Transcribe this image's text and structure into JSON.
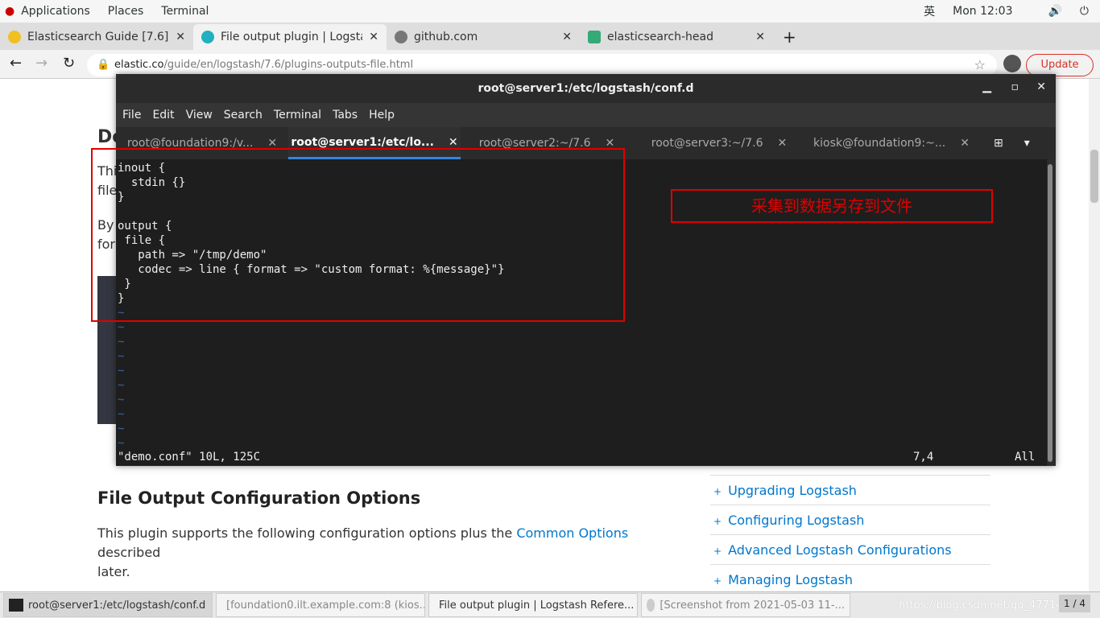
{
  "topbar": {
    "applications": "Applications",
    "places": "Places",
    "terminal": "Terminal",
    "ime": "英",
    "clock": "Mon 12:03"
  },
  "browser": {
    "tabs": [
      {
        "title": "Elasticsearch Guide [7.6] |"
      },
      {
        "title": "File output plugin | Logstash"
      },
      {
        "title": "github.com"
      },
      {
        "title": "elasticsearch-head"
      }
    ],
    "url_host": "elastic.co",
    "url_path": "/guide/en/logstash/7.6/plugins-outputs-file.html",
    "update": "Update"
  },
  "page": {
    "heading_partial": "De",
    "p1a": "Thi",
    "p1b": "file",
    "p2a": "By",
    "p2b": "forr",
    "section_heading": "File Output Configuration Options",
    "para_pre": "This plugin supports the following configuration options plus the ",
    "para_link": "Common Options",
    "para_post": " described",
    "para_line2": "later.",
    "sidebar": [
      "Upgrading Logstash",
      "Configuring Logstash",
      "Advanced Logstash Configurations",
      "Managing Logstash"
    ]
  },
  "terminal": {
    "title": "root@server1:/etc/logstash/conf.d",
    "menu": [
      "File",
      "Edit",
      "View",
      "Search",
      "Terminal",
      "Tabs",
      "Help"
    ],
    "tabs": [
      "root@foundation9:/v...",
      "root@server1:/etc/lo...",
      "root@server2:~/7.6",
      "root@server3:~/7.6",
      "kiosk@foundation9:~..."
    ],
    "lines": [
      "inout {",
      "  stdin {}",
      "}",
      "",
      "output {",
      " file {",
      "   path => \"/tmp/demo\"",
      "   codec => line { format => \"custom format: %{message}\"}",
      " }",
      "}"
    ],
    "tildes": 10,
    "status_left": "\"demo.conf\" 10L, 125C",
    "status_pos": "7,4",
    "status_all": "All",
    "annotation": "采集到数据另存到文件",
    "annotation_color": "#e00000"
  },
  "taskbar": [
    {
      "label": "root@server1:/etc/logstash/conf.d"
    },
    {
      "label": "[foundation0.ilt.example.com:8 (kios..."
    },
    {
      "label": "File output plugin | Logstash Refere..."
    },
    {
      "label": "[Screenshot from 2021-05-03 11-..."
    }
  ],
  "workspace": "1 / 4",
  "watermark": "https://blog.csdn.net/qq_47714288"
}
